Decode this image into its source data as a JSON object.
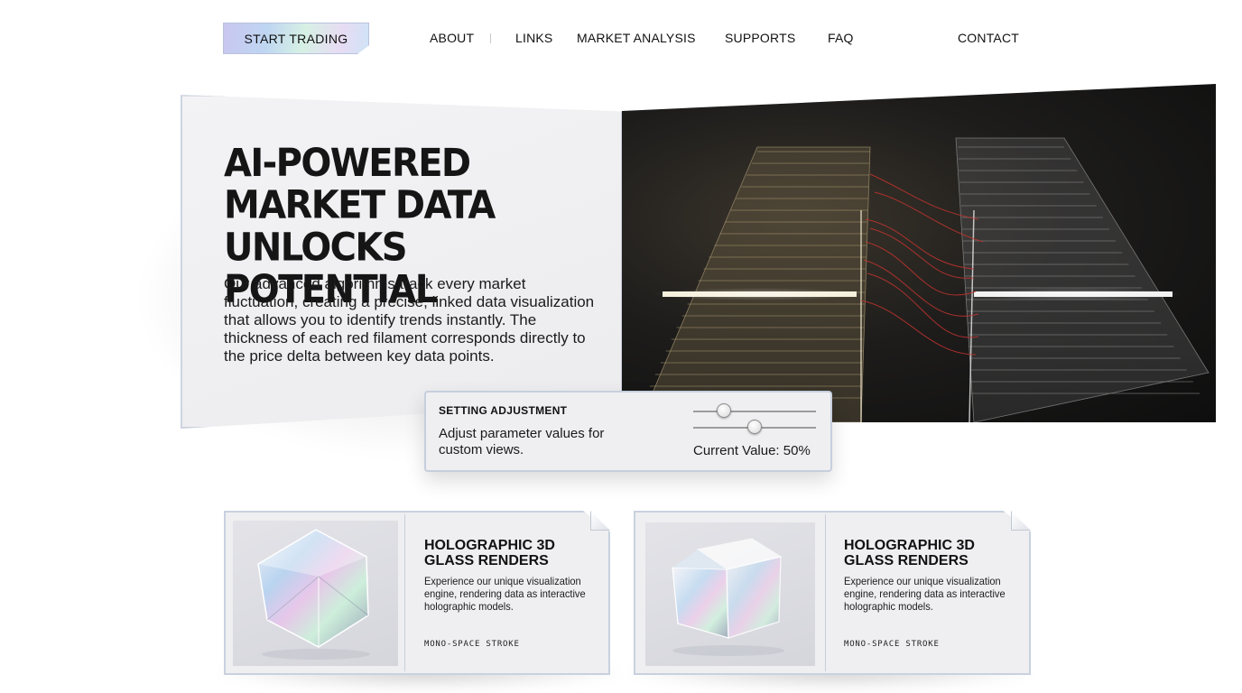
{
  "nav": {
    "start_trading": "START TRADING",
    "links": [
      "ABOUT",
      "LINKS",
      "MARKET ANALYSIS",
      "SUPPORTS",
      "FAQ",
      "CONTACT"
    ]
  },
  "hero": {
    "title": "AI-POWERED MARKET DATA UNLOCKS POTENTIAL",
    "body": "Our advanced algorithms track every market fluctuation, creating a precise, linked data visualization that allows you to identify trends instantly. The thickness of each red filament corresponds directly to the price delta between key data points.",
    "image_icon": "glass-data-towers"
  },
  "settings": {
    "title": "SETTING ADJUSTMENT",
    "description": "Adjust parameter values for custom views.",
    "current_value": "Current Value: 50%",
    "slider_1_level": 0.25,
    "slider_2_level": 0.5
  },
  "cards": [
    {
      "title": "HOLOGRAPHIC 3D GLASS RENDERS",
      "description": "Experience our unique visualization engine, rendering data as interactive holographic models.",
      "tag": "MONO-SPACE STROKE",
      "image_icon": "holographic-dodecahedron"
    },
    {
      "title": "HOLOGRAPHIC 3D GLASS RENDERS",
      "description": "Experience our unique visualization engine, rendering data as interactive holographic models.",
      "tag": "MONO-SPACE STROKE",
      "image_icon": "holographic-cube"
    }
  ],
  "colors": {
    "accent_filament": "#c2342e",
    "glow": "#f4efe2",
    "border": "#c8d1de"
  }
}
